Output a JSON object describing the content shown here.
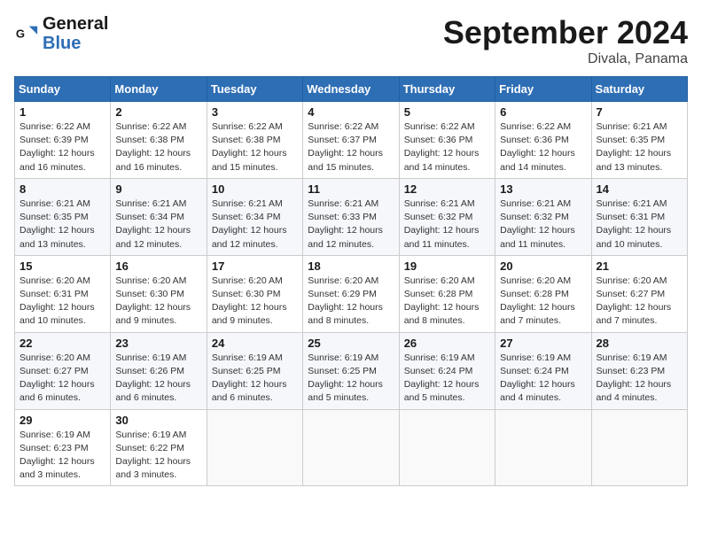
{
  "logo": {
    "line1": "General",
    "line2": "Blue"
  },
  "title": "September 2024",
  "location": "Divala, Panama",
  "days_header": [
    "Sunday",
    "Monday",
    "Tuesday",
    "Wednesday",
    "Thursday",
    "Friday",
    "Saturday"
  ],
  "weeks": [
    [
      {
        "day": "1",
        "info": "Sunrise: 6:22 AM\nSunset: 6:39 PM\nDaylight: 12 hours\nand 16 minutes."
      },
      {
        "day": "2",
        "info": "Sunrise: 6:22 AM\nSunset: 6:38 PM\nDaylight: 12 hours\nand 16 minutes."
      },
      {
        "day": "3",
        "info": "Sunrise: 6:22 AM\nSunset: 6:38 PM\nDaylight: 12 hours\nand 15 minutes."
      },
      {
        "day": "4",
        "info": "Sunrise: 6:22 AM\nSunset: 6:37 PM\nDaylight: 12 hours\nand 15 minutes."
      },
      {
        "day": "5",
        "info": "Sunrise: 6:22 AM\nSunset: 6:36 PM\nDaylight: 12 hours\nand 14 minutes."
      },
      {
        "day": "6",
        "info": "Sunrise: 6:22 AM\nSunset: 6:36 PM\nDaylight: 12 hours\nand 14 minutes."
      },
      {
        "day": "7",
        "info": "Sunrise: 6:21 AM\nSunset: 6:35 PM\nDaylight: 12 hours\nand 13 minutes."
      }
    ],
    [
      {
        "day": "8",
        "info": "Sunrise: 6:21 AM\nSunset: 6:35 PM\nDaylight: 12 hours\nand 13 minutes."
      },
      {
        "day": "9",
        "info": "Sunrise: 6:21 AM\nSunset: 6:34 PM\nDaylight: 12 hours\nand 12 minutes."
      },
      {
        "day": "10",
        "info": "Sunrise: 6:21 AM\nSunset: 6:34 PM\nDaylight: 12 hours\nand 12 minutes."
      },
      {
        "day": "11",
        "info": "Sunrise: 6:21 AM\nSunset: 6:33 PM\nDaylight: 12 hours\nand 12 minutes."
      },
      {
        "day": "12",
        "info": "Sunrise: 6:21 AM\nSunset: 6:32 PM\nDaylight: 12 hours\nand 11 minutes."
      },
      {
        "day": "13",
        "info": "Sunrise: 6:21 AM\nSunset: 6:32 PM\nDaylight: 12 hours\nand 11 minutes."
      },
      {
        "day": "14",
        "info": "Sunrise: 6:21 AM\nSunset: 6:31 PM\nDaylight: 12 hours\nand 10 minutes."
      }
    ],
    [
      {
        "day": "15",
        "info": "Sunrise: 6:20 AM\nSunset: 6:31 PM\nDaylight: 12 hours\nand 10 minutes."
      },
      {
        "day": "16",
        "info": "Sunrise: 6:20 AM\nSunset: 6:30 PM\nDaylight: 12 hours\nand 9 minutes."
      },
      {
        "day": "17",
        "info": "Sunrise: 6:20 AM\nSunset: 6:30 PM\nDaylight: 12 hours\nand 9 minutes."
      },
      {
        "day": "18",
        "info": "Sunrise: 6:20 AM\nSunset: 6:29 PM\nDaylight: 12 hours\nand 8 minutes."
      },
      {
        "day": "19",
        "info": "Sunrise: 6:20 AM\nSunset: 6:28 PM\nDaylight: 12 hours\nand 8 minutes."
      },
      {
        "day": "20",
        "info": "Sunrise: 6:20 AM\nSunset: 6:28 PM\nDaylight: 12 hours\nand 7 minutes."
      },
      {
        "day": "21",
        "info": "Sunrise: 6:20 AM\nSunset: 6:27 PM\nDaylight: 12 hours\nand 7 minutes."
      }
    ],
    [
      {
        "day": "22",
        "info": "Sunrise: 6:20 AM\nSunset: 6:27 PM\nDaylight: 12 hours\nand 6 minutes."
      },
      {
        "day": "23",
        "info": "Sunrise: 6:19 AM\nSunset: 6:26 PM\nDaylight: 12 hours\nand 6 minutes."
      },
      {
        "day": "24",
        "info": "Sunrise: 6:19 AM\nSunset: 6:25 PM\nDaylight: 12 hours\nand 6 minutes."
      },
      {
        "day": "25",
        "info": "Sunrise: 6:19 AM\nSunset: 6:25 PM\nDaylight: 12 hours\nand 5 minutes."
      },
      {
        "day": "26",
        "info": "Sunrise: 6:19 AM\nSunset: 6:24 PM\nDaylight: 12 hours\nand 5 minutes."
      },
      {
        "day": "27",
        "info": "Sunrise: 6:19 AM\nSunset: 6:24 PM\nDaylight: 12 hours\nand 4 minutes."
      },
      {
        "day": "28",
        "info": "Sunrise: 6:19 AM\nSunset: 6:23 PM\nDaylight: 12 hours\nand 4 minutes."
      }
    ],
    [
      {
        "day": "29",
        "info": "Sunrise: 6:19 AM\nSunset: 6:23 PM\nDaylight: 12 hours\nand 3 minutes."
      },
      {
        "day": "30",
        "info": "Sunrise: 6:19 AM\nSunset: 6:22 PM\nDaylight: 12 hours\nand 3 minutes."
      },
      {
        "day": "",
        "info": ""
      },
      {
        "day": "",
        "info": ""
      },
      {
        "day": "",
        "info": ""
      },
      {
        "day": "",
        "info": ""
      },
      {
        "day": "",
        "info": ""
      }
    ]
  ]
}
